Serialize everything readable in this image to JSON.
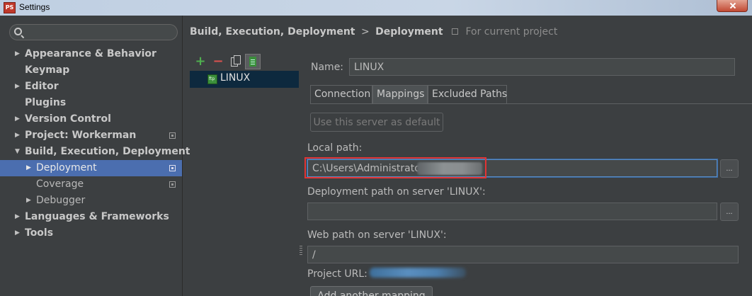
{
  "window": {
    "title": "Settings"
  },
  "search": {
    "placeholder": ""
  },
  "sidebar": {
    "items": [
      {
        "label": "Appearance & Behavior"
      },
      {
        "label": "Keymap"
      },
      {
        "label": "Editor"
      },
      {
        "label": "Plugins"
      },
      {
        "label": "Version Control"
      },
      {
        "label": "Project: Workerman"
      },
      {
        "label": "Build, Execution, Deployment"
      },
      {
        "label": "Deployment"
      },
      {
        "label": "Coverage"
      },
      {
        "label": "Debugger"
      },
      {
        "label": "Languages & Frameworks"
      },
      {
        "label": "Tools"
      }
    ]
  },
  "breadcrumb": {
    "parent": "Build, Execution, Deployment",
    "separator": ">",
    "current": "Deployment",
    "scope": "For current project"
  },
  "toolbar": {
    "add": "+",
    "remove": "−"
  },
  "servers": [
    {
      "name": "LINUX"
    }
  ],
  "form": {
    "name_label": "Name:",
    "name_value": "LINUX",
    "tabs": [
      {
        "label": "Connection"
      },
      {
        "label": "Mappings"
      },
      {
        "label": "Excluded Paths"
      }
    ],
    "use_default_label": "Use this server as default",
    "local_path_label": "Local path:",
    "local_path_value": "C:\\Users\\Administrato",
    "browse_label": "...",
    "deployment_path_label": "Deployment path on server 'LINUX':",
    "deployment_path_value": "",
    "web_path_label": "Web path on server 'LINUX':",
    "web_path_value": "/",
    "project_url_label": "Project URL:",
    "add_mapping_label": "Add another mapping"
  }
}
